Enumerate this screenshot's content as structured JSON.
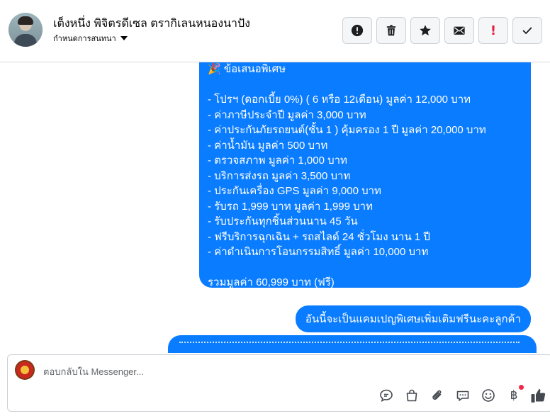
{
  "header": {
    "title": "เต็งหนึ่ง พิจิตรดีเซล ตรากิเลนหนองนาปัง",
    "subtitle": "กำหนดการสนทนา",
    "actions": [
      {
        "name": "spam-button",
        "icon": "alert-circle-icon"
      },
      {
        "name": "delete-button",
        "icon": "trash-icon"
      },
      {
        "name": "star-button",
        "icon": "star-icon"
      },
      {
        "name": "mail-button",
        "icon": "envelope-icon"
      },
      {
        "name": "priority-button",
        "icon": "exclamation-icon",
        "label": "!"
      },
      {
        "name": "done-button",
        "icon": "check-icon"
      }
    ]
  },
  "messages": {
    "offer_title": "🎉 ข้อเสนอพิเศษ",
    "offer_lines": [
      "- โปรฯ (ดอกเบี้ย 0%) ( 6 หรือ 12เดือน)     มูลค่า 12,000 บาท",
      "- ค่าภาษีประจำปี     มูลค่า 3,000 บาท",
      "- ค่าประกันภัยรถยนต์(ชั้น 1 ) คุ้มครอง 1 ปี     มูลค่า 20,000 บาท",
      "- ค่าน้ำมัน     มูลค่า 500 บาท",
      "- ตรวจสภาพ     มูลค่า 1,000 บาท",
      "- บริการส่งรถ     มูลค่า 3,500 บาท",
      "- ประกันเครื่อง GPS     มูลค่า 9,000 บาท",
      "- รับรถ 1,999 บาท     มูลค่า 1,999 บาท",
      "- รับประกันทุกชิ้นส่วนนาน 45 วัน",
      "- ฟรีบริการฉุกเฉิน + รถสไลด์ 24 ชั่วโมง นาน 1 ปี",
      "- ค่าดำเนินการโอนกรรมสิทธิ์     มูลค่า 10,000 บาท"
    ],
    "offer_total": "รวมมูลค่า 60,999 บาท (ฟรี)",
    "campaign_note": "อันนี้จะเป็นแคมเปญพิเศษเพิ่มเติมฟรีนะคะลูกค้า"
  },
  "composer": {
    "placeholder": "ตอบกลับใน Messenger...",
    "tools": [
      "chat-reply-icon",
      "bag-icon",
      "paperclip-icon",
      "comment-icon",
      "emoji-icon",
      "baht-icon",
      "thumbs-up-icon"
    ],
    "baht_symbol": "฿"
  },
  "colors": {
    "bubble": "#0a7cff",
    "like": "#444950",
    "badge": "#f02849"
  }
}
